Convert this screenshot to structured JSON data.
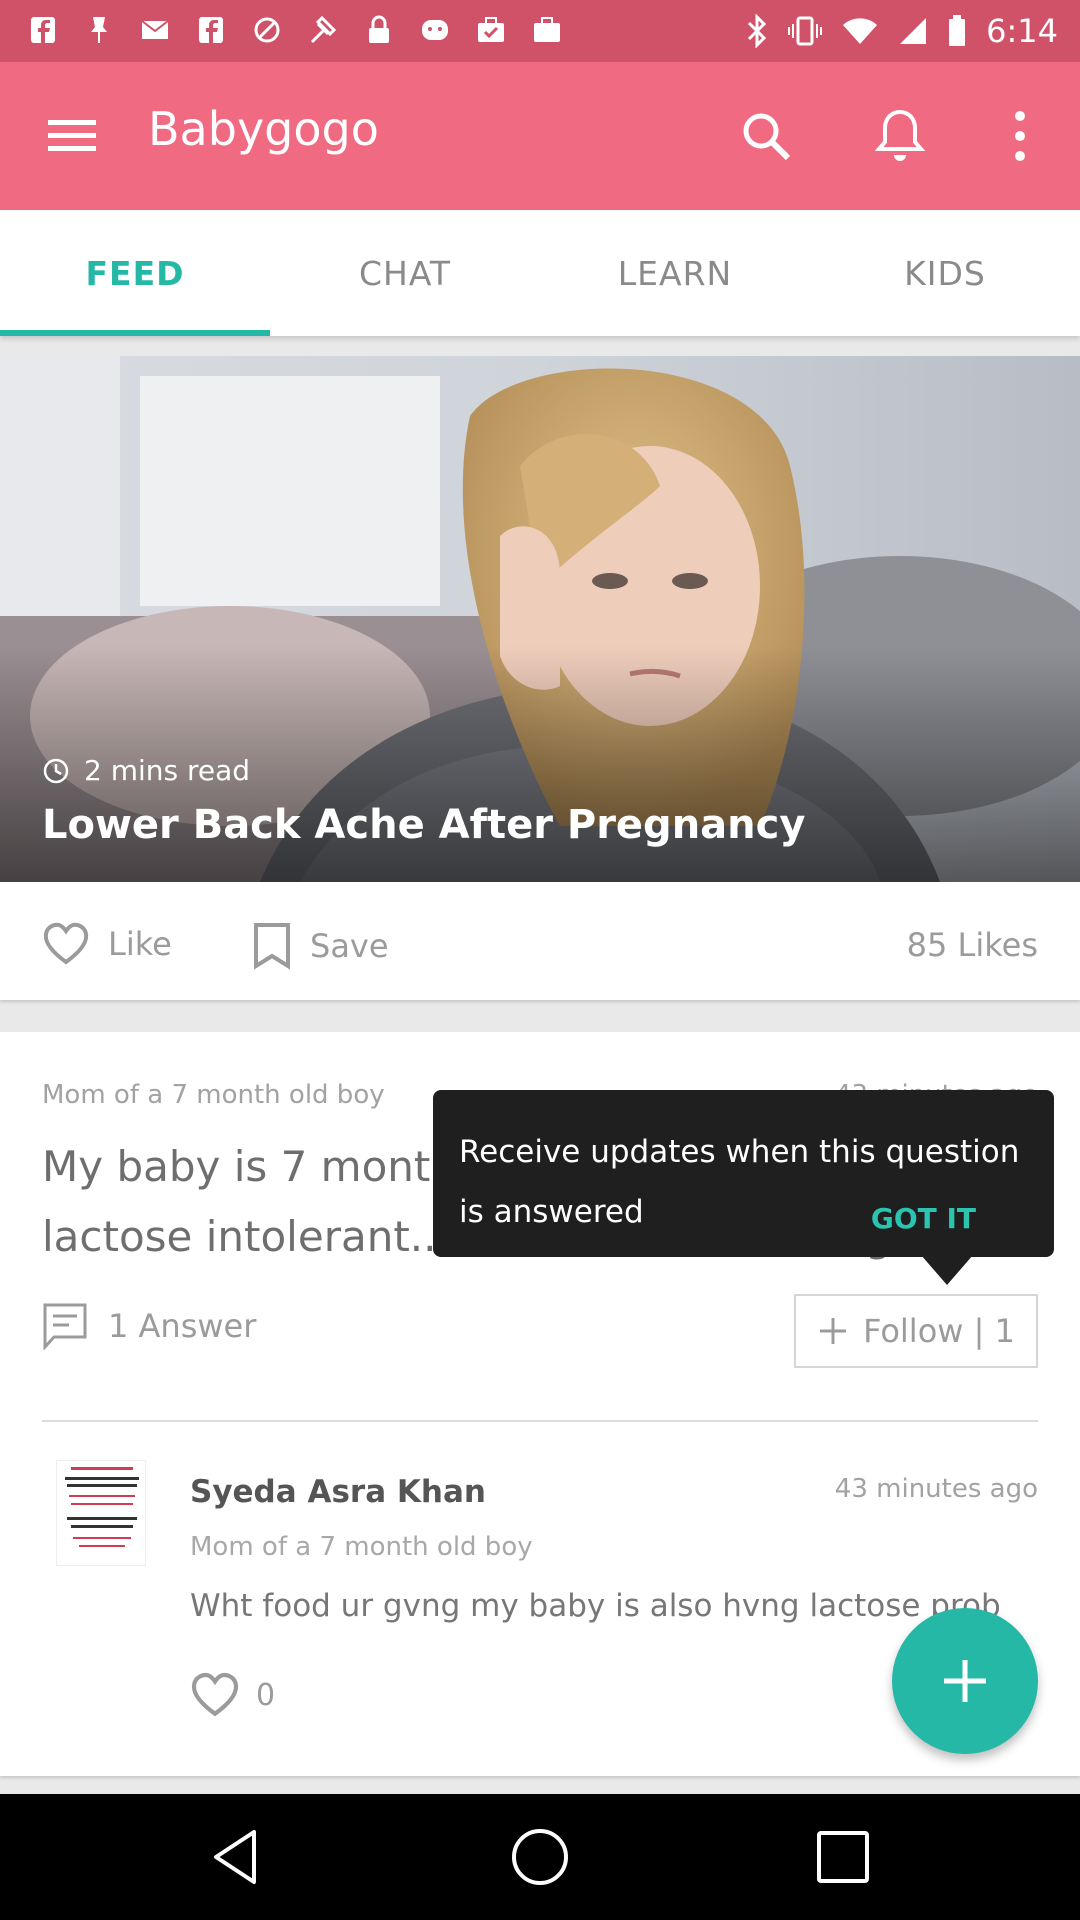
{
  "status_bar": {
    "time": "6:14",
    "left_icons": [
      "facebook-icon",
      "pin-icon",
      "mail-icon",
      "facebook-icon",
      "blocked-icon",
      "fake-gps-icon",
      "lock-icon",
      "app-icon",
      "briefcase-check-icon",
      "briefcase-icon"
    ],
    "right_icons": [
      "bluetooth-icon",
      "vibrate-icon",
      "wifi-icon",
      "signal-icon",
      "battery-icon"
    ]
  },
  "app_bar": {
    "title": "Babygogo",
    "icons": [
      "menu-icon",
      "search-icon",
      "bell-icon",
      "more-vertical-icon"
    ],
    "color": "#f06a82"
  },
  "tabs": [
    {
      "label": "FEED",
      "active": true
    },
    {
      "label": "CHAT",
      "active": false
    },
    {
      "label": "LEARN",
      "active": false
    },
    {
      "label": "KIDS",
      "active": false
    }
  ],
  "article": {
    "read_time": "2 mins read",
    "title": "Lower Back Ache After Pregnancy",
    "like_label": "Like",
    "save_label": "Save",
    "likes_count": "85 Likes"
  },
  "question": {
    "author_meta": "Mom of a 7 month old boy",
    "time": "43 minutes ago",
    "text": "My baby is 7 months 12 days now.. he is a lactose intolerant.. what food should b given t...",
    "answers_label": "1 Answer",
    "follow_label": "Follow | 1"
  },
  "answer": {
    "author_name": "Syeda Asra Khan",
    "time": "43 minutes ago",
    "author_meta": "Mom of a 7 month old boy",
    "text": "Wht food ur gvng my baby is also hvng lactose prob",
    "likes": "0",
    "avatar_text": "Practice Makes A Man Perfect, Then What About A Woman? Don't Think So Hard..!! She Is Born Perfect! Dedicated To All Lovely Ladies"
  },
  "tooltip": {
    "text": "Receive updates when this question is answered",
    "action": "GOT IT"
  },
  "colors": {
    "accent": "#26b8a6",
    "brand": "#f06a82",
    "status_bar": "#cf5269"
  },
  "nav_bar": {
    "buttons": [
      "back-icon",
      "home-icon",
      "recents-icon"
    ]
  }
}
